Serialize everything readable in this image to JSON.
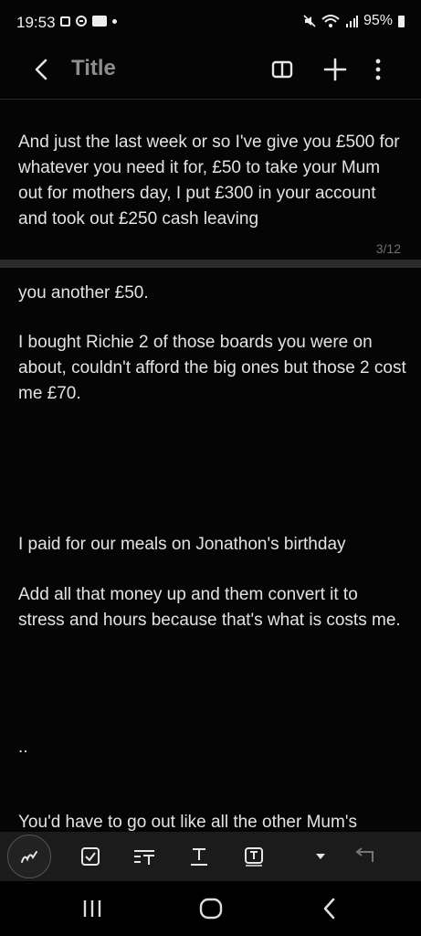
{
  "status_bar": {
    "time": "19:53",
    "battery": "95%"
  },
  "app_bar": {
    "title": "Title"
  },
  "note": {
    "paragraph1": "And just the last week or so I've give you £500 for whatever you need it for, £50 to take your Mum out for mothers day, I put £300 in your account and took out £250 cash leaving",
    "page_indicator": "3/12",
    "paragraph2": "you another £50.",
    "paragraph3": "I bought Richie 2 of those boards you were on about, couldn't afford the big ones but those 2 cost me £70.",
    "paragraph4": "I paid for our meals on Jonathon's birthday",
    "paragraph5": "Add all that money up and them convert it to stress and hours because that's what is costs me.",
    "paragraph6": "..",
    "paragraph7": "You'd have to go out like all the other Mum's"
  },
  "icons": {
    "back": "back-arrow-icon",
    "reading_mode": "book-icon",
    "add": "plus-icon",
    "more": "more-vert-icon",
    "pen": "pen-icon",
    "checkbox": "checkbox-icon",
    "text_format": "text-format-icon",
    "text_style": "text-style-icon",
    "text_box": "text-box-icon",
    "dropdown": "dropdown-icon",
    "undo": "undo-icon"
  }
}
